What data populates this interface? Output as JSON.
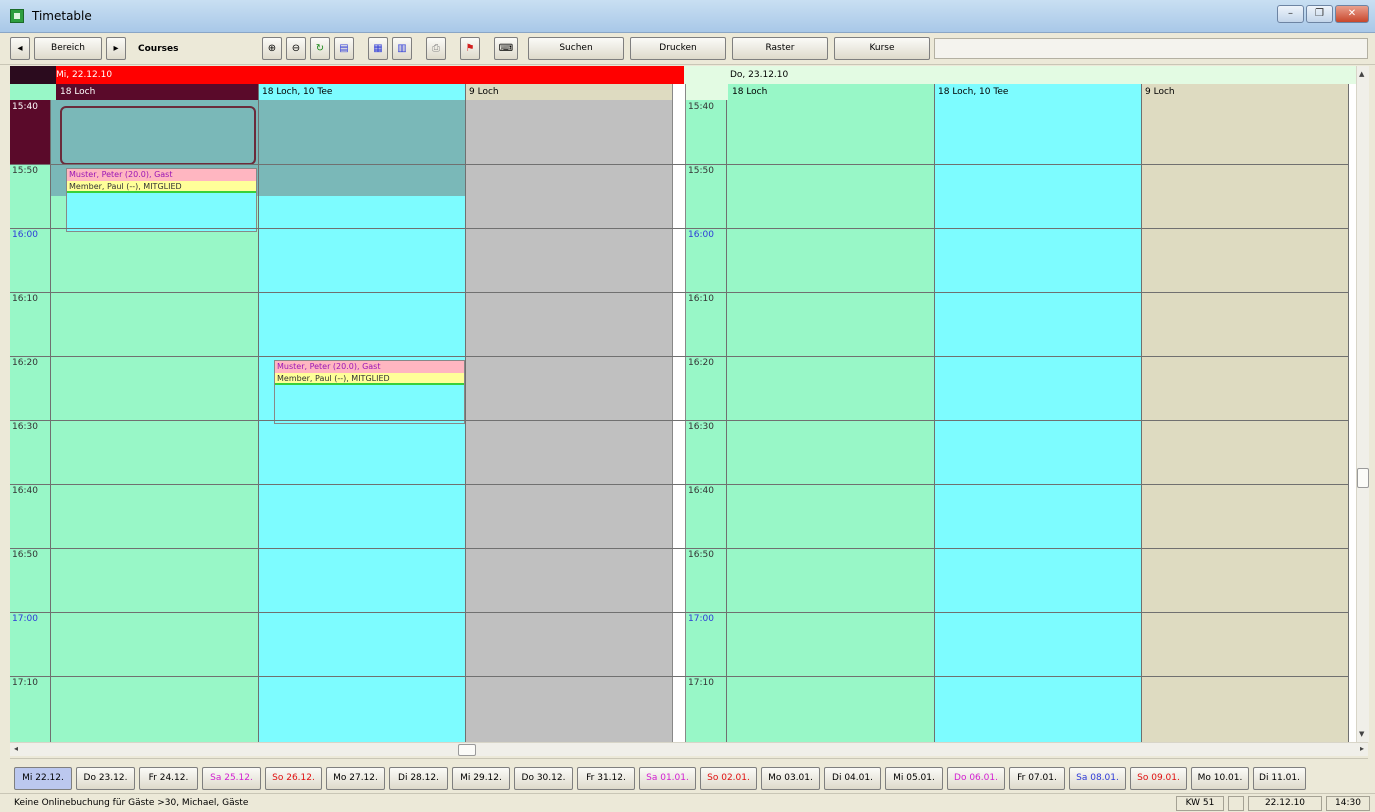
{
  "window": {
    "title": "Timetable"
  },
  "toolbar": {
    "prev": "◂",
    "bereich": "Bereich",
    "next": "▸",
    "courses": "Courses",
    "suchen": "Suchen",
    "drucken": "Drucken",
    "raster": "Raster",
    "kurse": "Kurse"
  },
  "times": [
    "15:40",
    "15:50",
    "16:00",
    "16:10",
    "16:20",
    "16:30",
    "16:40",
    "16:50",
    "17:00",
    "17:10"
  ],
  "days": [
    {
      "date": "Mi, 22.12.10",
      "columns": [
        "18 Loch",
        "18 Loch, 10 Tee",
        "9 Loch"
      ]
    },
    {
      "date": "Do, 23.12.10",
      "columns": [
        "18 Loch",
        "18 Loch, 10 Tee",
        "9 Loch"
      ]
    }
  ],
  "bookings": [
    {
      "players": [
        "Muster, Peter (20.0), Gast",
        "Member, Paul (--), MITGLIED"
      ]
    },
    {
      "players": [
        "Muster, Peter (20.0), Gast",
        "Member, Paul (--), MITGLIED"
      ]
    }
  ],
  "date_tabs": [
    {
      "label": "Mi 22.12.",
      "color": "#000000",
      "selected": true
    },
    {
      "label": "Do 23.12.",
      "color": "#000000"
    },
    {
      "label": "Fr 24.12.",
      "color": "#000000"
    },
    {
      "label": "Sa 25.12.",
      "color": "#d21fd2"
    },
    {
      "label": "So 26.12.",
      "color": "#e01010"
    },
    {
      "label": "Mo 27.12.",
      "color": "#000000"
    },
    {
      "label": "Di 28.12.",
      "color": "#000000"
    },
    {
      "label": "Mi 29.12.",
      "color": "#000000"
    },
    {
      "label": "Do 30.12.",
      "color": "#000000"
    },
    {
      "label": "Fr 31.12.",
      "color": "#000000"
    },
    {
      "label": "Sa 01.01.",
      "color": "#d21fd2"
    },
    {
      "label": "So 02.01.",
      "color": "#e01010"
    },
    {
      "label": "Mo 03.01.",
      "color": "#000000"
    },
    {
      "label": "Di 04.01.",
      "color": "#000000"
    },
    {
      "label": "Mi 05.01.",
      "color": "#000000"
    },
    {
      "label": "Do 06.01.",
      "color": "#d21fd2"
    },
    {
      "label": "Fr 07.01.",
      "color": "#000000"
    },
    {
      "label": "Sa 08.01.",
      "color": "#2d3ad8"
    },
    {
      "label": "So 09.01.",
      "color": "#e01010"
    },
    {
      "label": "Mo 10.01.",
      "color": "#000000"
    },
    {
      "label": "Di 11.01.",
      "color": "#000000"
    }
  ],
  "status": {
    "message": "Keine Onlinebuchung für Gäste >30, Michael, Gäste",
    "week": "KW 51",
    "date": "22.12.10",
    "time": "14:30"
  },
  "colors": {
    "day1_header": "#ff0000",
    "day1_selected": "#5a0a2a",
    "day2_header": "#e3fbe3",
    "col_green": "#98f7c7",
    "col_cyan": "#7dfcff",
    "col_grey": "#c0c0c0",
    "col_beige": "#dedbc1",
    "booked_teal": "#7ab8b8",
    "player_guest": "#ffb6c1",
    "player_member": "#ffff99"
  }
}
